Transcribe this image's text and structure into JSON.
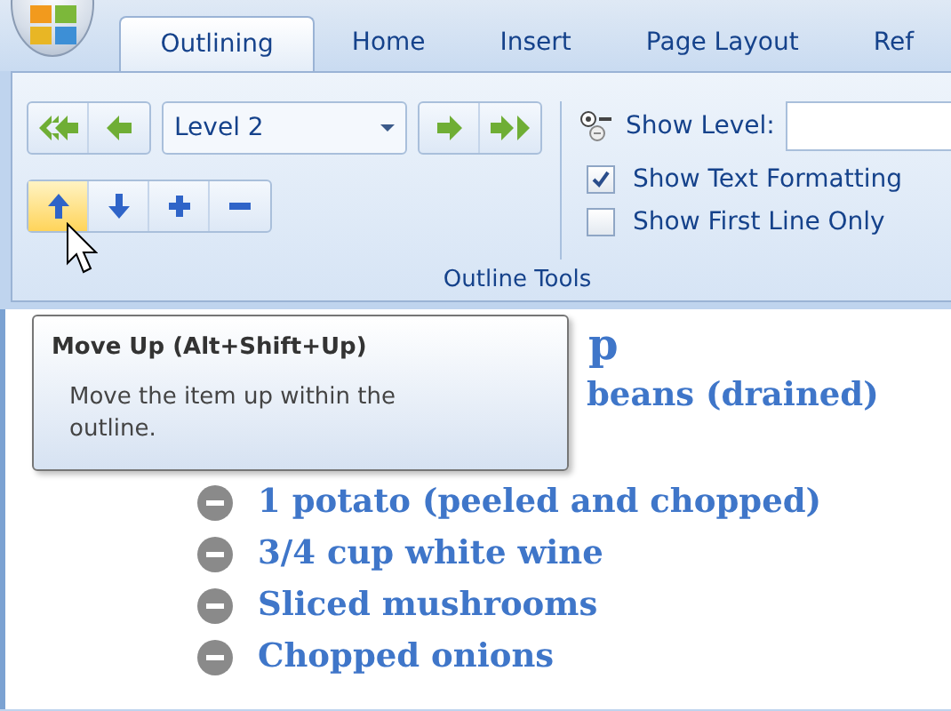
{
  "tabs": [
    {
      "label": "Outlining",
      "selected": true
    },
    {
      "label": "Home",
      "selected": false
    },
    {
      "label": "Insert",
      "selected": false
    },
    {
      "label": "Page Layout",
      "selected": false
    },
    {
      "label": "Ref",
      "selected": false
    }
  ],
  "ribbon": {
    "level_buttons": [
      {
        "kind": "promote-heading"
      },
      {
        "kind": "promote"
      }
    ],
    "level_dropdown": {
      "value": "Level 2"
    },
    "demote_buttons": [
      {
        "kind": "demote"
      },
      {
        "kind": "demote-body"
      }
    ],
    "move_buttons": [
      {
        "kind": "up",
        "hovered": true
      },
      {
        "kind": "down",
        "hovered": false
      },
      {
        "kind": "expand",
        "hovered": false
      },
      {
        "kind": "collapse",
        "hovered": false
      }
    ],
    "show_level": {
      "label": "Show Level:"
    },
    "options": [
      {
        "label": "Show Text Formatting",
        "checked": true
      },
      {
        "label": "Show First Line Only",
        "checked": false
      }
    ],
    "group_label": "Outline Tools"
  },
  "tooltip": {
    "title": "Move Up (Alt+Shift+Up)",
    "body": "Move the item up within the outline."
  },
  "document": {
    "heading": "p",
    "line": "beans (drained)",
    "items": [
      {
        "text": "1 potato (peeled and chopped)"
      },
      {
        "text": "3/4 cup white wine"
      },
      {
        "text": "Sliced mushrooms"
      },
      {
        "text": "Chopped onions"
      }
    ]
  }
}
